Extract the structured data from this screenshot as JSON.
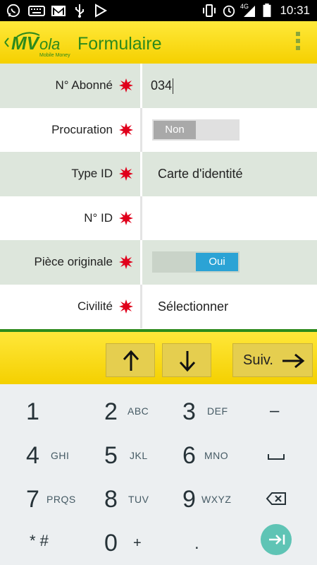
{
  "status_bar": {
    "time": "10:31",
    "network": "4G",
    "left_icons": [
      "whatsapp-icon",
      "keyboard-icon",
      "gmail-icon",
      "usb-icon",
      "play-store-icon"
    ],
    "right_icons": [
      "vibrate-icon",
      "alarm-icon",
      "signal-icon",
      "battery-icon"
    ]
  },
  "app_bar": {
    "logo_text": "MVola",
    "logo_subtext": "Mobile Money",
    "title": "Formulaire",
    "menu_icon": "overflow-menu-icon"
  },
  "form": {
    "fields": [
      {
        "label": "N° Abonné",
        "value": "034"
      },
      {
        "label": "Procuration",
        "toggle": "Non"
      },
      {
        "label": "Type ID",
        "value": "Carte d'identité"
      },
      {
        "label": "N° ID",
        "value": ""
      },
      {
        "label": "Pièce originale",
        "toggle": "Oui"
      },
      {
        "label": "Civilité",
        "value": "Sélectionner"
      }
    ],
    "required_icon": "required-star-icon"
  },
  "nav": {
    "next_label": "Suiv."
  },
  "keyboard": {
    "keys": [
      {
        "digit": "1",
        "letters": ""
      },
      {
        "digit": "2",
        "letters": "ABC"
      },
      {
        "digit": "3",
        "letters": "DEF"
      },
      {
        "digit": "4",
        "letters": "GHI"
      },
      {
        "digit": "5",
        "letters": "JKL"
      },
      {
        "digit": "6",
        "letters": "MNO"
      },
      {
        "digit": "7",
        "letters": "PRQS"
      },
      {
        "digit": "8",
        "letters": "TUV"
      },
      {
        "digit": "9",
        "letters": "WXYZ"
      },
      {
        "digit": "0",
        "letters": "+"
      }
    ],
    "minus": "–",
    "star_hash": "* #",
    "dot": "."
  },
  "colors": {
    "app_bar": "#f5d000",
    "title_green": "#2d8a1c",
    "row_alt": "#dde6dc",
    "toggle_on": "#2ba3d5",
    "required_red": "#e0001b",
    "enter_key": "#5fc4b5"
  }
}
